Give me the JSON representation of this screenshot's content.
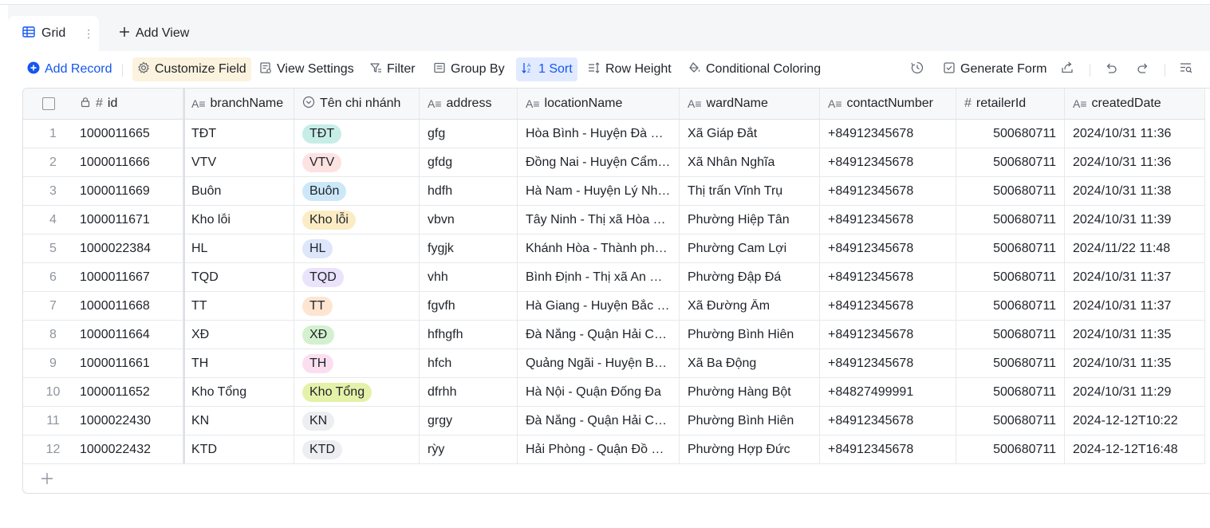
{
  "tabs": {
    "grid_label": "Grid",
    "add_view_label": "Add View"
  },
  "toolbar": {
    "add_record": "Add Record",
    "customize_field": "Customize Field",
    "view_settings": "View Settings",
    "filter": "Filter",
    "group_by": "Group By",
    "sort": "1 Sort",
    "row_height": "Row Height",
    "conditional_coloring": "Conditional Coloring",
    "generate_form": "Generate Form"
  },
  "columns": [
    "id",
    "branchName",
    "Tên chi nhánh",
    "address",
    "locationName",
    "wardName",
    "contactNumber",
    "retailerId",
    "createdDate"
  ],
  "rows": [
    {
      "n": "1",
      "id": "1000011665",
      "branch": "TĐT",
      "ten": "TĐT",
      "tag_bg": "#c7ede7",
      "addr": "gfg",
      "loc": "Hòa Bình - Huyện Đà Bắc",
      "ward": "Xã Giáp Đắt",
      "contact": "+84912345678",
      "ret": "500680711",
      "created": "2024/10/31 11:36"
    },
    {
      "n": "2",
      "id": "1000011666",
      "branch": "VTV",
      "ten": "VTV",
      "tag_bg": "#fde2e2",
      "addr": "gfdg",
      "loc": "Đồng Nai - Huyện Cẩm Mỹ",
      "ward": "Xã Nhân Nghĩa",
      "contact": "+84912345678",
      "ret": "500680711",
      "created": "2024/10/31 11:36"
    },
    {
      "n": "3",
      "id": "1000011669",
      "branch": "Buôn",
      "ten": "Buôn",
      "tag_bg": "#cce8f8",
      "addr": "hdfh",
      "loc": "Hà Nam - Huyện Lý Nhân",
      "ward": "Thị trấn Vĩnh Trụ",
      "contact": "+84912345678",
      "ret": "500680711",
      "created": "2024/10/31 11:38"
    },
    {
      "n": "4",
      "id": "1000011671",
      "branch": "Kho lỗi",
      "ten": "Kho lỗi",
      "tag_bg": "#fcecc4",
      "addr": "vbvn",
      "loc": "Tây Ninh - Thị xã Hòa Thành",
      "ward": "Phường Hiệp Tân",
      "contact": "+84912345678",
      "ret": "500680711",
      "created": "2024/10/31 11:39"
    },
    {
      "n": "5",
      "id": "1000022384",
      "branch": "HL",
      "ten": "HL",
      "tag_bg": "#dde6fb",
      "addr": "fygjk",
      "loc": "Khánh Hòa - Thành phố Cam Ranh",
      "ward": "Phường Cam Lợi",
      "contact": "+84912345678",
      "ret": "500680711",
      "created": "2024/11/22 11:48"
    },
    {
      "n": "6",
      "id": "1000011667",
      "branch": "TQD",
      "ten": "TQD",
      "tag_bg": "#ebe2fb",
      "addr": "vhh",
      "loc": "Bình Định - Thị xã An Nhơn",
      "ward": "Phường Đập Đá",
      "contact": "+84912345678",
      "ret": "500680711",
      "created": "2024/10/31 11:37"
    },
    {
      "n": "7",
      "id": "1000011668",
      "branch": "TT",
      "ten": "TT",
      "tag_bg": "#fde5d2",
      "addr": "fgvfh",
      "loc": "Hà Giang - Huyện Bắc Mê",
      "ward": "Xã Đường Âm",
      "contact": "+84912345678",
      "ret": "500680711",
      "created": "2024/10/31 11:37"
    },
    {
      "n": "8",
      "id": "1000011664",
      "branch": "XĐ",
      "ten": "XĐ",
      "tag_bg": "#d3f1cf",
      "addr": "hfhgfh",
      "loc": "Đà Nẵng - Quận Hải Châu",
      "ward": "Phường Bình Hiên",
      "contact": "+84912345678",
      "ret": "500680711",
      "created": "2024/10/31 11:35"
    },
    {
      "n": "9",
      "id": "1000011661",
      "branch": "TH",
      "ten": "TH",
      "tag_bg": "#fbdff0",
      "addr": "hfch",
      "loc": "Quảng Ngãi - Huyện Ba Tơ",
      "ward": "Xã Ba Động",
      "contact": "+84912345678",
      "ret": "500680711",
      "created": "2024/10/31 11:35"
    },
    {
      "n": "10",
      "id": "1000011652",
      "branch": "Kho Tổng",
      "ten": "Kho Tổng",
      "tag_bg": "#e4f2a9",
      "addr": "dfrhh",
      "loc": "Hà Nội - Quận Đống Đa",
      "ward": "Phường Hàng Bột",
      "contact": "+84827499991",
      "ret": "500680711",
      "created": "2024/10/31 11:29"
    },
    {
      "n": "11",
      "id": "1000022430",
      "branch": "KN",
      "ten": "KN",
      "tag_bg": "#eceef1",
      "addr": "grgy",
      "loc": "Đà Nẵng - Quận Hải Châu",
      "ward": "Phường Bình Hiên",
      "contact": "+84912345678",
      "ret": "500680711",
      "created": "2024-12-12T10:22"
    },
    {
      "n": "12",
      "id": "1000022432",
      "branch": "KTD",
      "ten": "KTD",
      "tag_bg": "#eceef1",
      "addr": "rỳy",
      "loc": "Hải Phòng - Quận Đồ Sơn",
      "ward": "Phường Hợp Đức",
      "contact": "+84912345678",
      "ret": "500680711",
      "created": "2024-12-12T16:48"
    }
  ],
  "colors": {
    "accent": "#1456f0",
    "customize_bg": "#fcf3de",
    "sort_bg": "#e1eaff"
  }
}
